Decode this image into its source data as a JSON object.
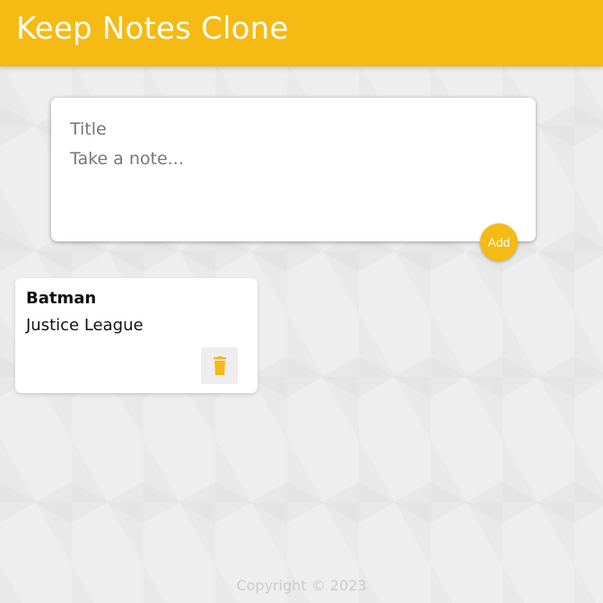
{
  "header": {
    "title": "Keep Notes Clone"
  },
  "create_area": {
    "title_placeholder": "Title",
    "content_placeholder": "Take a note...",
    "add_label": "Add"
  },
  "notes": [
    {
      "title": "Batman",
      "content": "Justice League",
      "delete_icon": "trash-icon"
    }
  ],
  "footer": {
    "text": "Copyright © 2023"
  },
  "colors": {
    "accent": "#f5ba13",
    "background": "#eeeeee"
  }
}
